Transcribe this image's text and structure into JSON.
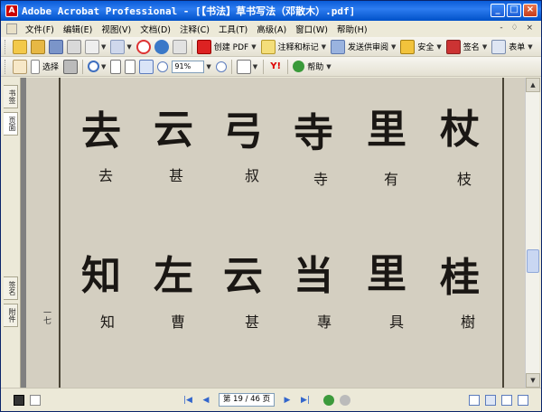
{
  "window": {
    "title": "Adobe Acrobat Professional - [【书法】草书写法（邓散木）.pdf]",
    "app_icon": "acrobat-icon",
    "controls": [
      "minimize-icon",
      "maximize-icon",
      "close-icon"
    ]
  },
  "menubar": {
    "items": [
      "文件(F)",
      "编辑(E)",
      "视图(V)",
      "文档(D)",
      "注释(C)",
      "工具(T)",
      "高级(A)",
      "窗口(W)",
      "帮助(H)"
    ],
    "right_controls": "- ♢ ×"
  },
  "toolbar1": {
    "create_pdf": "创建 PDF",
    "comment_markup": "注释和标记",
    "send_review": "发送供审阅",
    "secure": "安全",
    "sign": "签名",
    "forms": "表单"
  },
  "toolbar2": {
    "select_label": "选择",
    "zoom_value": "91%",
    "help_label": "帮助"
  },
  "leftnav": {
    "tabs": [
      "书签",
      "页面",
      "签名",
      "附件"
    ]
  },
  "document": {
    "page_side_number": "一七",
    "row1": [
      {
        "cursive": "杖",
        "label": "枝"
      },
      {
        "cursive": "里",
        "label": "有"
      },
      {
        "cursive": "寺",
        "label": "寺"
      },
      {
        "cursive": "弓",
        "label": "叔"
      },
      {
        "cursive": "云",
        "label": "甚"
      },
      {
        "cursive": "去",
        "label": "去"
      }
    ],
    "row2": [
      {
        "cursive": "桂",
        "label": "樹"
      },
      {
        "cursive": "里",
        "label": "具"
      },
      {
        "cursive": "当",
        "label": "專"
      },
      {
        "cursive": "云",
        "label": "甚"
      },
      {
        "cursive": "左",
        "label": "曹"
      },
      {
        "cursive": "知",
        "label": "知"
      }
    ]
  },
  "statusbar": {
    "page_field": "第 19 / 46 页"
  },
  "colors": {
    "title_bar": "#0a5cd8",
    "page_paper": "#d4cfc1",
    "ink": "#1a1714"
  }
}
